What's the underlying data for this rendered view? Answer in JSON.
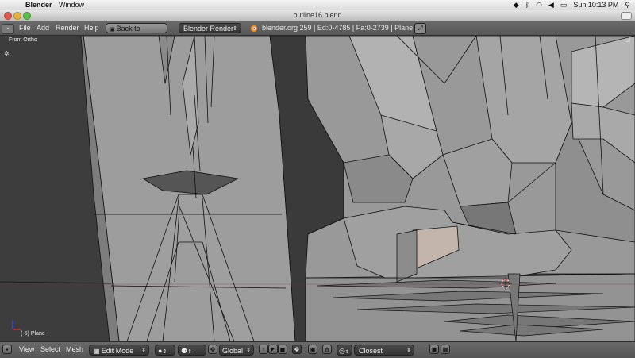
{
  "menubar": {
    "apple": "",
    "app_name": "Blender",
    "menu_window": "Window",
    "clock": "Sun 10:13 PM"
  },
  "window": {
    "title": "outline16.blend"
  },
  "info_header": {
    "menus": [
      "File",
      "Add",
      "Render",
      "Help"
    ],
    "back_button": "Back to Previous",
    "render_engine": "Blender Render",
    "stats": "blender.org 259 | Ed:0-4785 | Fa:0-2739 | Plane"
  },
  "viewport": {
    "view_label": "Front Ortho",
    "object_label": "(-5) Plane"
  },
  "bottom_header": {
    "menus": [
      "View",
      "Select",
      "Mesh"
    ],
    "mode": "Edit Mode",
    "orientation": "Global",
    "snap_target": "Closest"
  },
  "colors": {
    "background": "#3d3d3d",
    "mesh_face": "#9a9a9a",
    "mesh_edge": "#111111",
    "header": "#5f5f5f"
  }
}
